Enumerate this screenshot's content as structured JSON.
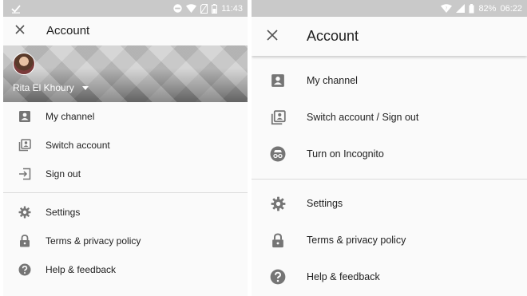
{
  "left": {
    "status": {
      "time": "11:43",
      "icons": [
        "checkmark-icon",
        "do-not-disturb-icon",
        "wifi-icon",
        "no-sim-icon",
        "battery-icon"
      ]
    },
    "appbar": {
      "title": "Account",
      "close_icon": "close-icon"
    },
    "header": {
      "account_name": "Rita El Khoury",
      "caret_icon": "caret-down-icon"
    },
    "menu": {
      "group1": [
        {
          "label": "My channel",
          "icon": "person-box-icon"
        },
        {
          "label": "Switch account",
          "icon": "switch-account-icon"
        },
        {
          "label": "Sign out",
          "icon": "sign-out-icon"
        }
      ],
      "group2": [
        {
          "label": "Settings",
          "icon": "gear-icon"
        },
        {
          "label": "Terms & privacy policy",
          "icon": "lock-icon"
        },
        {
          "label": "Help & feedback",
          "icon": "help-icon"
        }
      ]
    }
  },
  "right": {
    "status": {
      "battery": "82%",
      "time": "06:22",
      "icons": [
        "wifi-icon",
        "signal-icon",
        "battery-icon"
      ]
    },
    "appbar": {
      "title": "Account",
      "close_icon": "close-icon"
    },
    "menu": {
      "group1": [
        {
          "label": "My channel",
          "icon": "person-box-icon"
        },
        {
          "label": "Switch account / Sign out",
          "icon": "switch-account-icon"
        },
        {
          "label": "Turn on Incognito",
          "icon": "incognito-icon"
        }
      ],
      "group2": [
        {
          "label": "Settings",
          "icon": "gear-icon"
        },
        {
          "label": "Terms & privacy policy",
          "icon": "lock-icon"
        },
        {
          "label": "Help & feedback",
          "icon": "help-icon"
        }
      ]
    }
  },
  "colors": {
    "icon": "#757575",
    "statusbar": "#c9c9c9",
    "divider": "#dcdcdc",
    "background": "#fafafa"
  }
}
